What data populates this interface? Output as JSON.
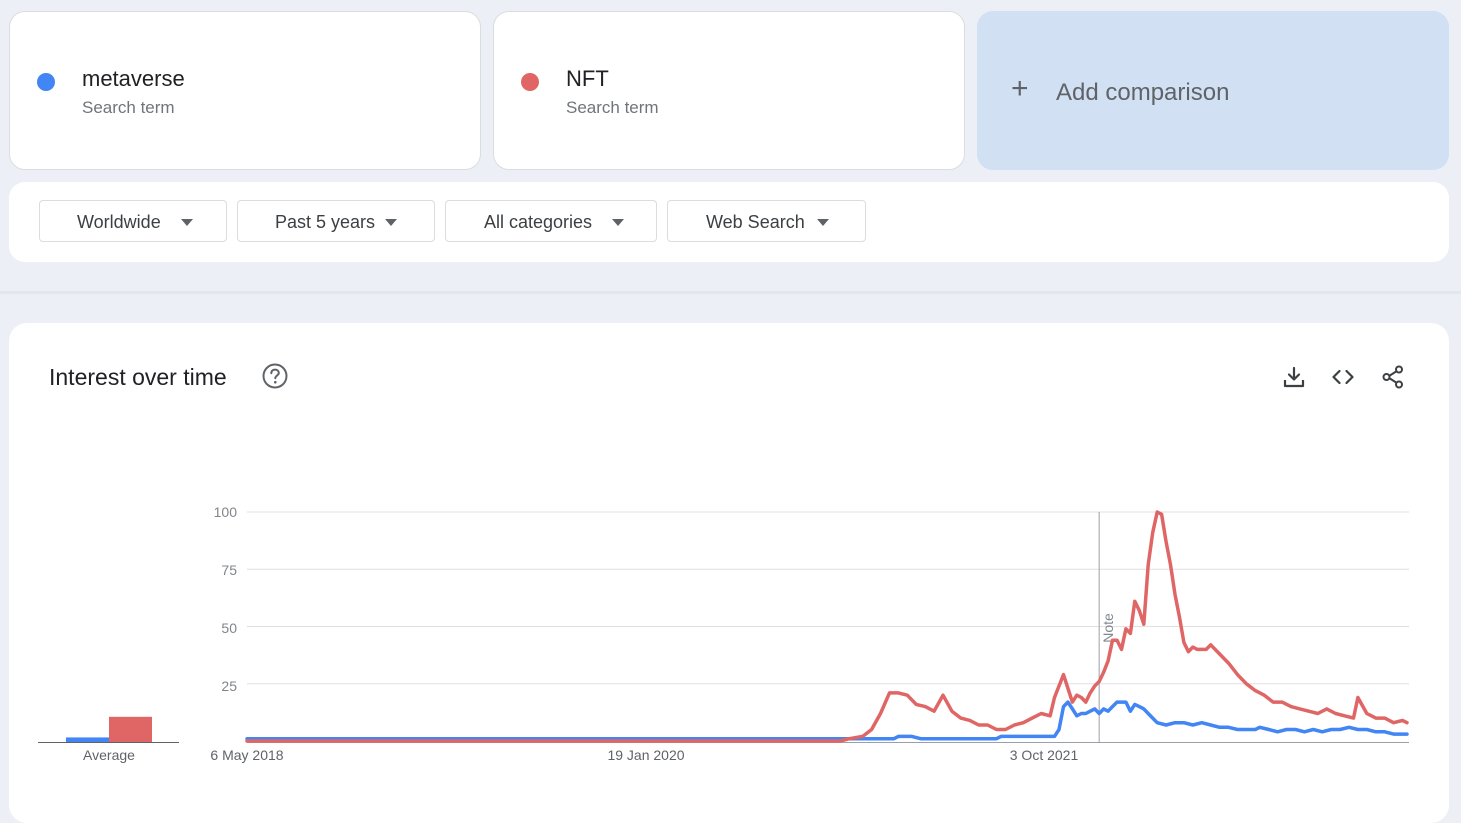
{
  "terms": [
    {
      "name": "metaverse",
      "sub": "Search term",
      "color": "#4285f4"
    },
    {
      "name": "NFT",
      "sub": "Search term",
      "color": "#e06666"
    }
  ],
  "add_comparison": {
    "plus": "+",
    "label": "Add comparison"
  },
  "filters": {
    "region": "Worldwide",
    "period": "Past 5 years",
    "category": "All categories",
    "search_type": "Web Search"
  },
  "panel": {
    "title": "Interest over time",
    "icons": [
      "help-icon",
      "download-icon",
      "embed-icon",
      "share-icon"
    ]
  },
  "chart_data": {
    "type": "line",
    "title": "Interest over time",
    "ylim": [
      0,
      100
    ],
    "yticks": [
      "100",
      "75",
      "50",
      "25"
    ],
    "x_labels": [
      "6 May 2018",
      "19 Jan 2020",
      "3 Oct 2021"
    ],
    "x_range": [
      "2018-05-06",
      "2023-04-30"
    ],
    "grid": true,
    "note": {
      "date": "2022-01-02",
      "label": "Note"
    },
    "average": {
      "label": "Average",
      "values": [
        2,
        11
      ]
    },
    "series": [
      {
        "name": "metaverse",
        "color": "#4285f4",
        "points": [
          [
            "2018-05-06",
            1
          ],
          [
            "2020-11-29",
            1
          ],
          [
            "2021-02-14",
            1
          ],
          [
            "2021-02-21",
            2
          ],
          [
            "2021-03-14",
            2
          ],
          [
            "2021-03-28",
            1
          ],
          [
            "2021-07-25",
            1
          ],
          [
            "2021-08-01",
            2
          ],
          [
            "2021-10-24",
            2
          ],
          [
            "2021-10-31",
            5
          ],
          [
            "2021-11-07",
            15
          ],
          [
            "2021-11-14",
            17
          ],
          [
            "2021-11-21",
            14
          ],
          [
            "2021-11-28",
            11
          ],
          [
            "2021-12-05",
            12
          ],
          [
            "2021-12-12",
            12
          ],
          [
            "2021-12-19",
            13
          ],
          [
            "2021-12-26",
            14
          ],
          [
            "2022-01-02",
            12
          ],
          [
            "2022-01-09",
            14
          ],
          [
            "2022-01-16",
            13
          ],
          [
            "2022-01-23",
            15
          ],
          [
            "2022-01-30",
            17
          ],
          [
            "2022-02-06",
            17
          ],
          [
            "2022-02-13",
            17
          ],
          [
            "2022-02-20",
            13
          ],
          [
            "2022-02-27",
            16
          ],
          [
            "2022-03-06",
            15
          ],
          [
            "2022-03-13",
            14
          ],
          [
            "2022-03-20",
            12
          ],
          [
            "2022-03-27",
            10
          ],
          [
            "2022-04-03",
            8
          ],
          [
            "2022-04-17",
            7
          ],
          [
            "2022-05-01",
            8
          ],
          [
            "2022-05-15",
            8
          ],
          [
            "2022-05-29",
            7
          ],
          [
            "2022-06-12",
            8
          ],
          [
            "2022-06-26",
            7
          ],
          [
            "2022-07-10",
            6
          ],
          [
            "2022-07-24",
            6
          ],
          [
            "2022-08-07",
            5
          ],
          [
            "2022-08-21",
            5
          ],
          [
            "2022-09-04",
            5
          ],
          [
            "2022-09-11",
            6
          ],
          [
            "2022-09-25",
            5
          ],
          [
            "2022-10-09",
            4
          ],
          [
            "2022-10-23",
            5
          ],
          [
            "2022-11-06",
            5
          ],
          [
            "2022-11-20",
            4
          ],
          [
            "2022-12-04",
            5
          ],
          [
            "2022-12-18",
            4
          ],
          [
            "2023-01-01",
            5
          ],
          [
            "2023-01-15",
            5
          ],
          [
            "2023-01-29",
            6
          ],
          [
            "2023-02-12",
            5
          ],
          [
            "2023-02-26",
            5
          ],
          [
            "2023-03-12",
            4
          ],
          [
            "2023-03-26",
            4
          ],
          [
            "2023-04-09",
            3
          ],
          [
            "2023-04-23",
            3
          ],
          [
            "2023-04-30",
            3
          ]
        ]
      },
      {
        "name": "NFT",
        "color": "#e06666",
        "points": [
          [
            "2018-05-06",
            0
          ],
          [
            "2020-11-22",
            0
          ],
          [
            "2020-12-06",
            1
          ],
          [
            "2020-12-27",
            2
          ],
          [
            "2021-01-10",
            5
          ],
          [
            "2021-01-24",
            12
          ],
          [
            "2021-02-07",
            21
          ],
          [
            "2021-02-21",
            21
          ],
          [
            "2021-03-07",
            20
          ],
          [
            "2021-03-21",
            16
          ],
          [
            "2021-04-04",
            15
          ],
          [
            "2021-04-18",
            13
          ],
          [
            "2021-05-02",
            20
          ],
          [
            "2021-05-16",
            13
          ],
          [
            "2021-05-30",
            10
          ],
          [
            "2021-06-13",
            9
          ],
          [
            "2021-06-27",
            7
          ],
          [
            "2021-07-11",
            7
          ],
          [
            "2021-07-25",
            5
          ],
          [
            "2021-08-08",
            5
          ],
          [
            "2021-08-22",
            7
          ],
          [
            "2021-09-05",
            8
          ],
          [
            "2021-09-19",
            10
          ],
          [
            "2021-10-03",
            12
          ],
          [
            "2021-10-17",
            11
          ],
          [
            "2021-10-24",
            19
          ],
          [
            "2021-10-31",
            24
          ],
          [
            "2021-11-07",
            29
          ],
          [
            "2021-11-14",
            23
          ],
          [
            "2021-11-21",
            17
          ],
          [
            "2021-11-28",
            20
          ],
          [
            "2021-12-05",
            19
          ],
          [
            "2021-12-12",
            17
          ],
          [
            "2021-12-19",
            21
          ],
          [
            "2021-12-26",
            24
          ],
          [
            "2022-01-02",
            26
          ],
          [
            "2022-01-09",
            30
          ],
          [
            "2022-01-16",
            35
          ],
          [
            "2022-01-23",
            44
          ],
          [
            "2022-01-30",
            44
          ],
          [
            "2022-02-06",
            40
          ],
          [
            "2022-02-13",
            49
          ],
          [
            "2022-02-20",
            47
          ],
          [
            "2022-02-27",
            61
          ],
          [
            "2022-03-06",
            57
          ],
          [
            "2022-03-13",
            51
          ],
          [
            "2022-03-20",
            77
          ],
          [
            "2022-03-27",
            91
          ],
          [
            "2022-04-03",
            100
          ],
          [
            "2022-04-10",
            99
          ],
          [
            "2022-04-17",
            87
          ],
          [
            "2022-04-24",
            77
          ],
          [
            "2022-05-01",
            64
          ],
          [
            "2022-05-08",
            54
          ],
          [
            "2022-05-15",
            43
          ],
          [
            "2022-05-22",
            39
          ],
          [
            "2022-05-29",
            41
          ],
          [
            "2022-06-05",
            40
          ],
          [
            "2022-06-19",
            40
          ],
          [
            "2022-06-26",
            42
          ],
          [
            "2022-07-10",
            38
          ],
          [
            "2022-07-24",
            34
          ],
          [
            "2022-08-07",
            29
          ],
          [
            "2022-08-21",
            25
          ],
          [
            "2022-09-04",
            22
          ],
          [
            "2022-09-18",
            20
          ],
          [
            "2022-10-02",
            17
          ],
          [
            "2022-10-16",
            17
          ],
          [
            "2022-10-30",
            15
          ],
          [
            "2022-11-13",
            14
          ],
          [
            "2022-11-27",
            13
          ],
          [
            "2022-12-11",
            12
          ],
          [
            "2022-12-25",
            14
          ],
          [
            "2023-01-08",
            12
          ],
          [
            "2023-01-22",
            11
          ],
          [
            "2023-02-05",
            10
          ],
          [
            "2023-02-12",
            19
          ],
          [
            "2023-02-26",
            12
          ],
          [
            "2023-03-12",
            10
          ],
          [
            "2023-03-26",
            10
          ],
          [
            "2023-04-09",
            8
          ],
          [
            "2023-04-23",
            9
          ],
          [
            "2023-04-30",
            8
          ]
        ]
      }
    ]
  }
}
